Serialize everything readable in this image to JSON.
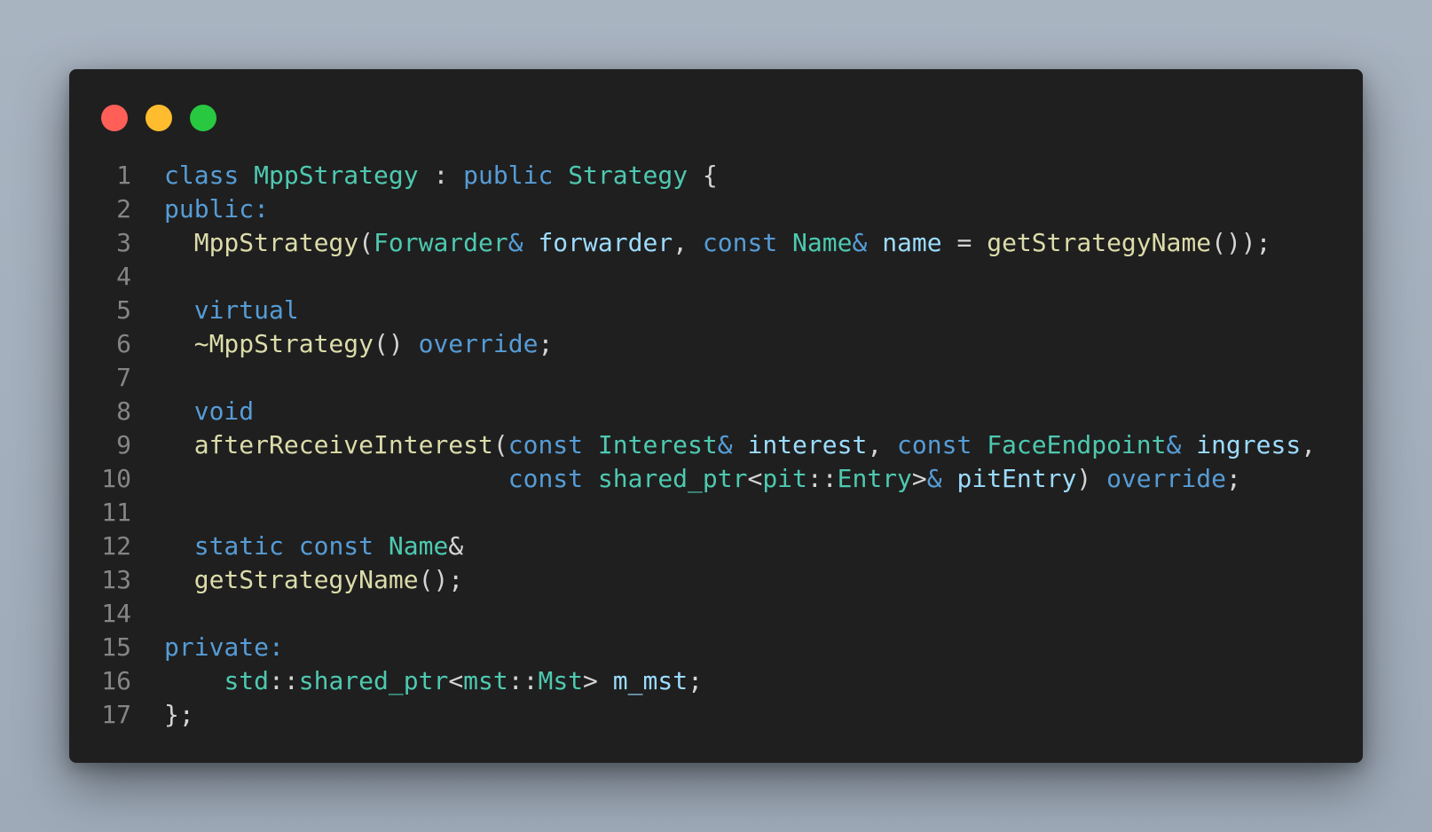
{
  "window": {
    "controls": [
      "close",
      "minimize",
      "maximize"
    ],
    "control_colors": {
      "close": "#ff5f57",
      "minimize": "#febc2e",
      "maximize": "#28c840"
    }
  },
  "theme": {
    "background": "#1f1f1f",
    "line_number": "#858585",
    "keyword": "#569cd6",
    "type": "#4ec9b0",
    "function": "#dcdcaa",
    "variable": "#9cdcfe",
    "punctuation": "#d4d4d4"
  },
  "code": {
    "lines": [
      {
        "n": "1",
        "tokens": [
          {
            "t": "class",
            "k": "kw"
          },
          {
            "t": " ",
            "k": "pun"
          },
          {
            "t": "MppStrategy",
            "k": "type"
          },
          {
            "t": " : ",
            "k": "pun"
          },
          {
            "t": "public",
            "k": "kw"
          },
          {
            "t": " ",
            "k": "pun"
          },
          {
            "t": "Strategy",
            "k": "type"
          },
          {
            "t": " {",
            "k": "pun"
          }
        ]
      },
      {
        "n": "2",
        "tokens": [
          {
            "t": "public:",
            "k": "kw"
          }
        ]
      },
      {
        "n": "3",
        "tokens": [
          {
            "t": "  ",
            "k": "pun"
          },
          {
            "t": "MppStrategy",
            "k": "fn"
          },
          {
            "t": "(",
            "k": "pun"
          },
          {
            "t": "Forwarder",
            "k": "type"
          },
          {
            "t": "&",
            "k": "kw"
          },
          {
            "t": " ",
            "k": "pun"
          },
          {
            "t": "forwarder",
            "k": "var"
          },
          {
            "t": ", ",
            "k": "pun"
          },
          {
            "t": "const",
            "k": "kw"
          },
          {
            "t": " ",
            "k": "pun"
          },
          {
            "t": "Name",
            "k": "type"
          },
          {
            "t": "&",
            "k": "kw"
          },
          {
            "t": " ",
            "k": "pun"
          },
          {
            "t": "name",
            "k": "var"
          },
          {
            "t": " = ",
            "k": "pun"
          },
          {
            "t": "getStrategyName",
            "k": "fn"
          },
          {
            "t": "());",
            "k": "pun"
          }
        ]
      },
      {
        "n": "4",
        "tokens": []
      },
      {
        "n": "5",
        "tokens": [
          {
            "t": "  ",
            "k": "pun"
          },
          {
            "t": "virtual",
            "k": "kw"
          }
        ]
      },
      {
        "n": "6",
        "tokens": [
          {
            "t": "  ",
            "k": "pun"
          },
          {
            "t": "~MppStrategy",
            "k": "fn"
          },
          {
            "t": "() ",
            "k": "pun"
          },
          {
            "t": "override",
            "k": "kw"
          },
          {
            "t": ";",
            "k": "pun"
          }
        ]
      },
      {
        "n": "7",
        "tokens": []
      },
      {
        "n": "8",
        "tokens": [
          {
            "t": "  ",
            "k": "pun"
          },
          {
            "t": "void",
            "k": "kw"
          }
        ]
      },
      {
        "n": "9",
        "tokens": [
          {
            "t": "  ",
            "k": "pun"
          },
          {
            "t": "afterReceiveInterest",
            "k": "fn"
          },
          {
            "t": "(",
            "k": "pun"
          },
          {
            "t": "const",
            "k": "kw"
          },
          {
            "t": " ",
            "k": "pun"
          },
          {
            "t": "Interest",
            "k": "type"
          },
          {
            "t": "&",
            "k": "kw"
          },
          {
            "t": " ",
            "k": "pun"
          },
          {
            "t": "interest",
            "k": "var"
          },
          {
            "t": ", ",
            "k": "pun"
          },
          {
            "t": "const",
            "k": "kw"
          },
          {
            "t": " ",
            "k": "pun"
          },
          {
            "t": "FaceEndpoint",
            "k": "type"
          },
          {
            "t": "&",
            "k": "kw"
          },
          {
            "t": " ",
            "k": "pun"
          },
          {
            "t": "ingress",
            "k": "var"
          },
          {
            "t": ",",
            "k": "pun"
          }
        ]
      },
      {
        "n": "10",
        "tokens": [
          {
            "t": "                       ",
            "k": "pun"
          },
          {
            "t": "const",
            "k": "kw"
          },
          {
            "t": " ",
            "k": "pun"
          },
          {
            "t": "shared_ptr",
            "k": "type"
          },
          {
            "t": "<",
            "k": "pun"
          },
          {
            "t": "pit",
            "k": "type"
          },
          {
            "t": "::",
            "k": "pun"
          },
          {
            "t": "Entry",
            "k": "type"
          },
          {
            "t": ">",
            "k": "pun"
          },
          {
            "t": "&",
            "k": "kw"
          },
          {
            "t": " ",
            "k": "pun"
          },
          {
            "t": "pitEntry",
            "k": "var"
          },
          {
            "t": ") ",
            "k": "pun"
          },
          {
            "t": "override",
            "k": "kw"
          },
          {
            "t": ";",
            "k": "pun"
          }
        ]
      },
      {
        "n": "11",
        "tokens": []
      },
      {
        "n": "12",
        "tokens": [
          {
            "t": "  ",
            "k": "pun"
          },
          {
            "t": "static",
            "k": "kw"
          },
          {
            "t": " ",
            "k": "pun"
          },
          {
            "t": "const",
            "k": "kw"
          },
          {
            "t": " ",
            "k": "pun"
          },
          {
            "t": "Name",
            "k": "type"
          },
          {
            "t": "&",
            "k": "pun"
          }
        ]
      },
      {
        "n": "13",
        "tokens": [
          {
            "t": "  ",
            "k": "pun"
          },
          {
            "t": "getStrategyName",
            "k": "fn"
          },
          {
            "t": "();",
            "k": "pun"
          }
        ]
      },
      {
        "n": "14",
        "tokens": []
      },
      {
        "n": "15",
        "tokens": [
          {
            "t": "private:",
            "k": "kw"
          }
        ]
      },
      {
        "n": "16",
        "tokens": [
          {
            "t": "    ",
            "k": "pun"
          },
          {
            "t": "std",
            "k": "type"
          },
          {
            "t": "::",
            "k": "pun"
          },
          {
            "t": "shared_ptr",
            "k": "type"
          },
          {
            "t": "<",
            "k": "pun"
          },
          {
            "t": "mst",
            "k": "type"
          },
          {
            "t": "::",
            "k": "pun"
          },
          {
            "t": "Mst",
            "k": "type"
          },
          {
            "t": "> ",
            "k": "pun"
          },
          {
            "t": "m_mst",
            "k": "var"
          },
          {
            "t": ";",
            "k": "pun"
          }
        ]
      },
      {
        "n": "17",
        "tokens": [
          {
            "t": "};",
            "k": "pun"
          }
        ]
      }
    ]
  }
}
